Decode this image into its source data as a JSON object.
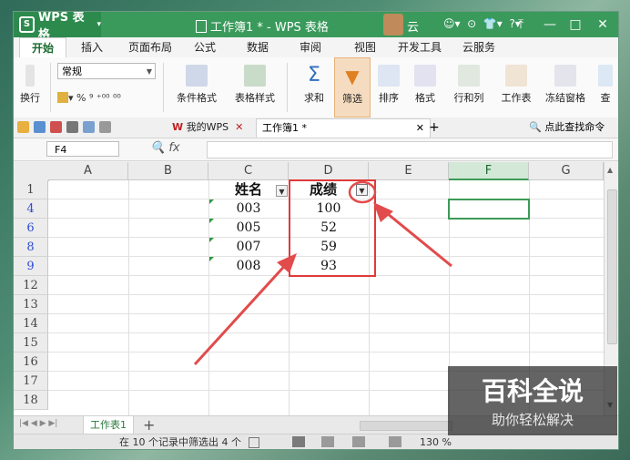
{
  "app": {
    "name": "WPS 表格",
    "window_title": "工作簿1 * - WPS 表格",
    "user": "云"
  },
  "menu": [
    "开始",
    "插入",
    "页面布局",
    "公式",
    "数据",
    "审阅",
    "视图",
    "开发工具",
    "云服务"
  ],
  "ribbon": {
    "number_format": "常规",
    "paste_label": "换行",
    "fmt_symbols": "% ⁹ ⁺⁰⁰ ⁰⁰",
    "buttons": [
      "条件格式",
      "表格样式",
      "求和",
      "筛选",
      "排序",
      "格式",
      "行和列",
      "工作表",
      "冻结窗格",
      "查"
    ]
  },
  "quickbar": {
    "my_wps": "我的WPS",
    "doc_tab": "工作簿1 *",
    "search": "点此查找命令"
  },
  "formula_bar": {
    "name_box": "F4",
    "fx": "fx",
    "value": ""
  },
  "columns": [
    "A",
    "B",
    "C",
    "D",
    "E",
    "F",
    "G"
  ],
  "rows": [
    "1",
    "4",
    "6",
    "8",
    "9",
    "12",
    "13",
    "14",
    "15",
    "16",
    "17",
    "18"
  ],
  "table": {
    "header": {
      "name": "姓名",
      "score": "成绩"
    },
    "records": [
      {
        "name": "003",
        "score": "100"
      },
      {
        "name": "005",
        "score": "52"
      },
      {
        "name": "007",
        "score": "59"
      },
      {
        "name": "008",
        "score": "93"
      }
    ]
  },
  "sheet_tabs": {
    "active": "工作表1",
    "add": "+"
  },
  "status": {
    "text": "在 10 个记录中筛选出 4 个",
    "zoom": "130 %"
  },
  "watermark": {
    "title": "百科全说",
    "subtitle": "助你轻松解决"
  },
  "colors": {
    "brand": "#3a9a5c",
    "highlight_box": "#e03a3a",
    "arrow": "#e24b4b",
    "filtered_row_num": "#2a4bd7"
  }
}
